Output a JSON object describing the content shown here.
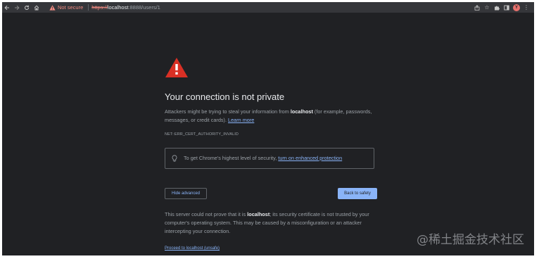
{
  "toolbar": {
    "back_icon": "back-arrow-icon",
    "forward_icon": "forward-arrow-icon",
    "reload_icon": "reload-icon",
    "home_icon": "home-icon",
    "security_status": "Not secure",
    "url_scheme": "https://",
    "url_host": "localhost",
    "url_path": ":8888/users/1",
    "profile_initial": "Y",
    "right_icons": [
      "share-icon",
      "star-icon",
      "extensions-icon",
      "side-panel-icon",
      "profile-avatar",
      "menu-icon"
    ]
  },
  "interstitial": {
    "title": "Your connection is not private",
    "para1_before": "Attackers might be trying to steal your information from ",
    "para1_host": "localhost",
    "para1_after": " (for example, passwords, messages, or credit cards). ",
    "learn_more": "Learn more",
    "error_code": "NET::ERR_CERT_AUTHORITY_INVALID",
    "enhanced_text": "To get Chrome's highest level of security, ",
    "enhanced_link": "turn on enhanced protection",
    "hide_advanced": "Hide advanced",
    "back_to_safety": "Back to safety",
    "para2_before": "This server could not prove that it is ",
    "para2_host": "localhost",
    "para2_after": "; its security certificate is not trusted by your computer's operating system. This may be caused by a misconfiguration or an attacker intercepting your connection.",
    "proceed_link": "Proceed to localhost (unsafe)"
  },
  "watermark": "@稀土掘金技术社区",
  "colors": {
    "background": "#202124",
    "toolbar": "#35363a",
    "warning_red": "#d93025",
    "link_blue": "#8ab4f8",
    "text": "#9aa0a6",
    "title": "#e8eaed"
  }
}
